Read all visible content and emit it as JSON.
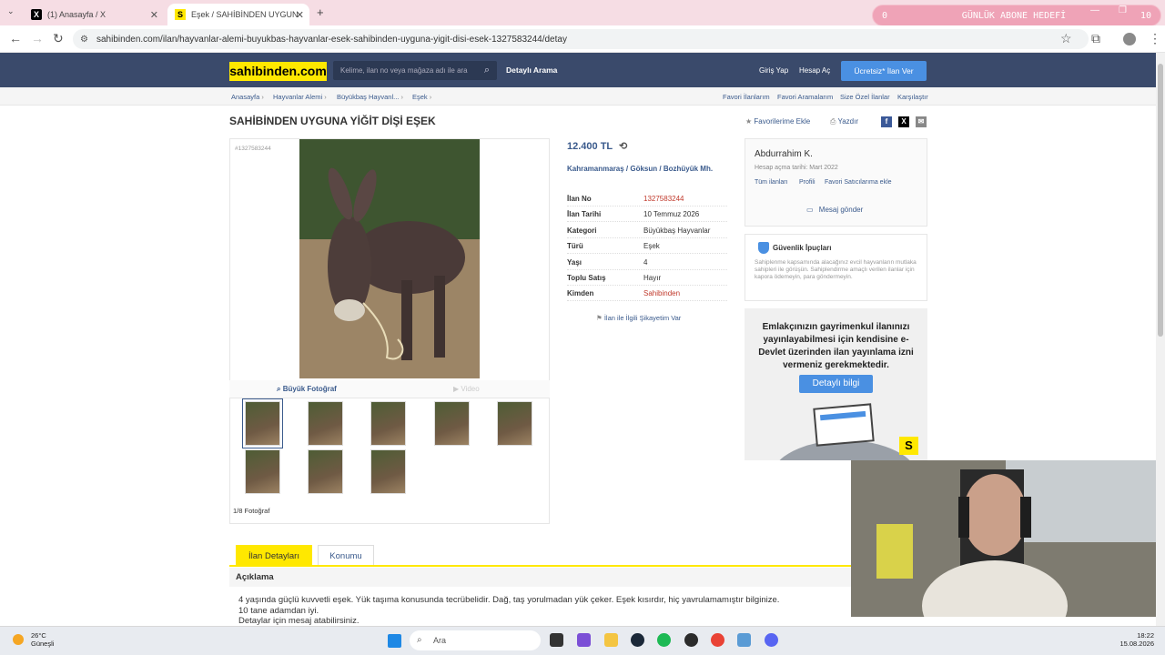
{
  "browser": {
    "tabs": [
      {
        "label": "(1) Anasayfa / X",
        "icon": "x-logo-icon"
      },
      {
        "label": "Eşek / SAHİBİNDEN UYGUNA Yİ",
        "icon": "sahibinden-icon"
      }
    ],
    "new_tab": "+",
    "url": "sahibinden.com/ilan/hayvanlar-alemi-buyukbas-hayvanlar-esek-sahibinden-uyguna-yigit-disi-esek-1327583244/detay",
    "overlay": {
      "left": "0",
      "title": "GÜNLÜK ABONE HEDEFİ",
      "right": "10"
    }
  },
  "header": {
    "logo": "sahibinden.com",
    "search_placeholder": "Kelime, ilan no veya mağaza adı ile ara",
    "detailed_search": "Detaylı Arama",
    "login": "Giriş Yap",
    "register": "Hesap Aç",
    "post_ad": "Ücretsiz* İlan Ver"
  },
  "breadcrumb": [
    "Anasayfa",
    "Hayvanlar Alemi",
    "Büyükbaş Hayvanl...",
    "Eşek"
  ],
  "right_links": [
    "Favori İlanlarım",
    "Favori Aramalarım",
    "Size Özel İlanlar",
    "Karşılaştır"
  ],
  "listing": {
    "title": "SAHİBİNDEN UYGUNA YİĞİT DİŞİ EŞEK",
    "add_fav": "Favorilerime Ekle",
    "print": "Yazdır",
    "id_label": "#1327583244",
    "big_photo": "Büyük Fotoğraf",
    "video": "Video",
    "photo_count": "1/8 Fotoğraf",
    "price": "12.400 TL",
    "location": [
      "Kahramanmaraş",
      "Göksun",
      "Bozhüyük Mh."
    ],
    "details": [
      {
        "k": "İlan No",
        "v": "1327583244",
        "red": true
      },
      {
        "k": "İlan Tarihi",
        "v": "10 Temmuz 2026",
        "red": false
      },
      {
        "k": "Kategori",
        "v": "Büyükbaş Hayvanlar",
        "red": false
      },
      {
        "k": "Türü",
        "v": "Eşek",
        "red": false
      },
      {
        "k": "Yaşı",
        "v": "4",
        "red": false
      },
      {
        "k": "Toplu Satış",
        "v": "Hayır",
        "red": false
      },
      {
        "k": "Kimden",
        "v": "Sahibinden",
        "red": true
      }
    ],
    "complaint": "İlan ile İlgili Şikayetim Var"
  },
  "seller": {
    "name": "Abdurrahim K.",
    "since": "Hesap açma tarihi: Mart 2022",
    "links": [
      "Tüm ilanları",
      "Profili",
      "Favori Satıcılarıma ekle"
    ],
    "message": "Mesaj gönder"
  },
  "security": {
    "title": "Güvenlik İpuçları",
    "text": "Sahiplenme kapsamında alacağınız evcil hayvanların mutlaka sahipleri ile görüşün. Sahiplendirme amaçlı verilen ilanlar için kapora ödemeyin, para göndermeyin."
  },
  "ad": {
    "text": "Emlakçınızın gayrimenkul ilanınızı yayınlayabilmesi için kendisine e-Devlet üzerinden ilan yayınlama izni vermeniz gerekmektedir.",
    "button": "Detaylı bilgi",
    "badge": "S"
  },
  "tabs": [
    "İlan Detayları",
    "Konumu"
  ],
  "description": {
    "heading": "Açıklama",
    "lines": [
      "4 yaşında güçlü kuvvetli eşek. Yük taşıma konusunda tecrübelidir. Dağ, taş yorulmadan yük çeker. Eşek kısırdır, hiç yavrulamamıştır bilginize.",
      "10 tane adamdan iyi.",
      "Detaylar için mesaj atabilirsiniz."
    ]
  },
  "taskbar": {
    "temp": "26°C",
    "weather": "Güneşli",
    "search": "Ara",
    "time": "18:22",
    "date": "15.08.2026"
  },
  "colors": {
    "brand_yellow": "#ffe800",
    "header_blue": "#3a4a6b",
    "link_blue": "#3a5a8c",
    "cta_blue": "#4a90e2",
    "red": "#c0392b"
  }
}
